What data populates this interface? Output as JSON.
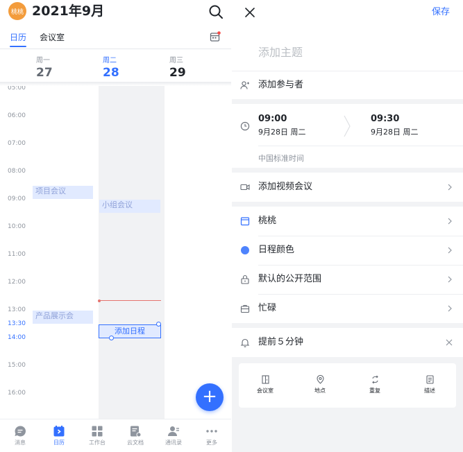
{
  "left": {
    "avatar_text": "桃桃",
    "month_title": "2021年9月",
    "tabs": [
      {
        "label": "日历"
      },
      {
        "label": "会议室"
      }
    ],
    "days": [
      {
        "week": "周一",
        "num": "27"
      },
      {
        "week": "周二",
        "num": "28"
      },
      {
        "week": "周三",
        "num": "29"
      }
    ],
    "hours": [
      "05:00",
      "06:00",
      "07:00",
      "08:00",
      "09:00",
      "10:00",
      "11:00",
      "12:00",
      "13:00",
      "13:30",
      "14:00",
      "15:00",
      "16:00"
    ],
    "events": [
      {
        "title": "项目会议"
      },
      {
        "title": "小组会议"
      },
      {
        "title": "产品展示会"
      }
    ],
    "add_event_label": "添加日程",
    "fab_symbol": "+",
    "nav": [
      {
        "label": "消息",
        "icon": "message-icon"
      },
      {
        "label": "日历",
        "icon": "calendar-icon"
      },
      {
        "label": "工作台",
        "icon": "workspace-icon"
      },
      {
        "label": "云文档",
        "icon": "docs-icon"
      },
      {
        "label": "通讯录",
        "icon": "contacts-icon"
      },
      {
        "label": "更多",
        "icon": "more-icon"
      }
    ],
    "colors": {
      "accent": "#3370ff",
      "event_bg": "#e1eaff",
      "now_line": "#e5736e",
      "avatar": "#f39c3c"
    }
  },
  "right": {
    "save_label": "保存",
    "subject_placeholder": "添加主题",
    "attendees_label": "添加参与者",
    "start": {
      "time": "09:00",
      "date": "9月28日 周二"
    },
    "end": {
      "time": "09:30",
      "date": "9月28日 周二"
    },
    "timezone": "中国标准时间",
    "video_label": "添加视频会议",
    "calendar_label": "桃桃",
    "color_label": "日程颜色",
    "visibility_label": "默认的公开范围",
    "busy_label": "忙碌",
    "reminder_label": "提前５分钟",
    "tools": [
      {
        "label": "会议室",
        "icon": "meeting-room-icon"
      },
      {
        "label": "地点",
        "icon": "location-icon"
      },
      {
        "label": "重复",
        "icon": "repeat-icon"
      },
      {
        "label": "描述",
        "icon": "description-icon"
      }
    ],
    "colors": {
      "event_color": "#4e83fd",
      "background": "#f2f3f5"
    }
  }
}
